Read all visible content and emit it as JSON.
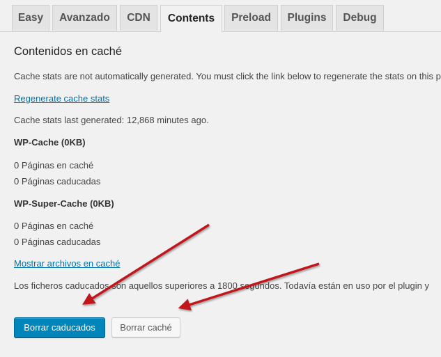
{
  "tabs": [
    {
      "label": "Easy"
    },
    {
      "label": "Avanzado"
    },
    {
      "label": "CDN"
    },
    {
      "label": "Contents",
      "active": true
    },
    {
      "label": "Preload"
    },
    {
      "label": "Plugins"
    },
    {
      "label": "Debug"
    }
  ],
  "section_title": "Contenidos en caché",
  "intro": "Cache stats are not automatically generated. You must click the link below to regenerate the stats on this page.",
  "regenerate_link": "Regenerate cache stats",
  "last_generated": "Cache stats last generated: 12,868 minutes ago.",
  "wp_cache": {
    "heading": "WP-Cache (0KB)",
    "cached": "0 Páginas en caché",
    "expired": "0 Páginas caducadas"
  },
  "wp_super_cache": {
    "heading": "WP-Super-Cache (0KB)",
    "cached": "0 Páginas en caché",
    "expired": "0 Páginas caducadas"
  },
  "show_files_link": "Mostrar archivos en caché",
  "expired_note": "Los ficheros caducados son aquellos superiores a 1800 segundos. Todavía están en uso por el plugin y",
  "buttons": {
    "delete_expired": "Borrar caducados",
    "delete_cache": "Borrar caché"
  },
  "colors": {
    "primary": "#0085ba",
    "link": "#0073aa",
    "arrow": "#c0141a"
  }
}
